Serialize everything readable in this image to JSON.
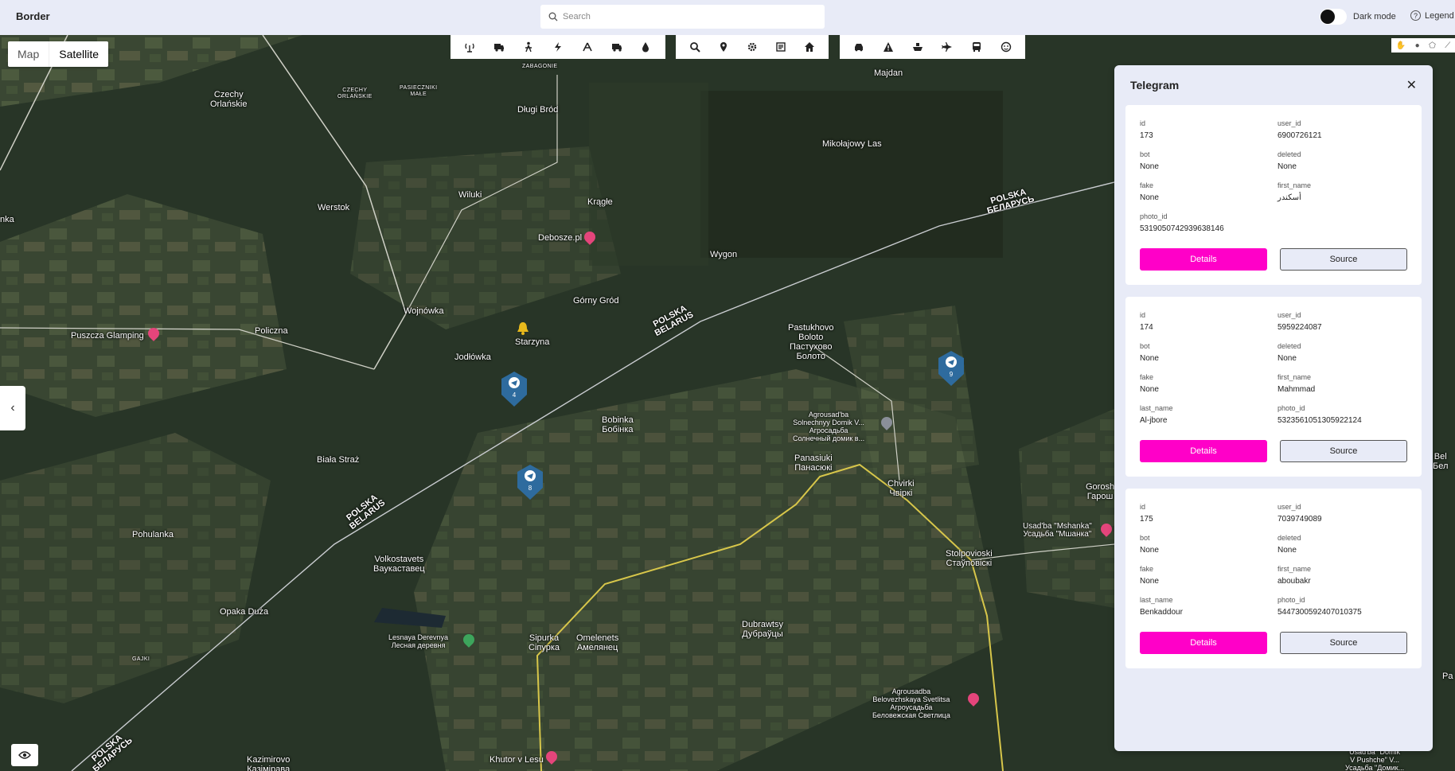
{
  "app": {
    "title": "Border"
  },
  "search": {
    "placeholder": "Search"
  },
  "header": {
    "dark_mode_label": "Dark mode",
    "legend_label": "Legend"
  },
  "map": {
    "type_map": "Map",
    "type_satellite": "Satellite",
    "places": [
      {
        "name": "ZABAGONIE"
      },
      {
        "name": "Majdan"
      },
      {
        "name": "Czechy\nOrlańskie"
      },
      {
        "name": "CZECHY\nORLAŃSKIE"
      },
      {
        "name": "PASIECZNIKI\nMAŁE"
      },
      {
        "name": "Długi Bród"
      },
      {
        "name": "Mikołajowy Las"
      },
      {
        "name": "Werstok"
      },
      {
        "name": "Wiluki"
      },
      {
        "name": "Krągłe"
      },
      {
        "name": "Debosze.pl"
      },
      {
        "name": "Wygon"
      },
      {
        "name": "Górny Gród"
      },
      {
        "name": "Wojnówka"
      },
      {
        "name": "Puszcza Glamping"
      },
      {
        "name": "Policzna"
      },
      {
        "name": "Starzyna"
      },
      {
        "name": "Jodłówka"
      },
      {
        "name": "Pastukhovo\nBoloto\nПастухово\nБолото"
      },
      {
        "name": "Bobinka\nБобінка"
      },
      {
        "name": "Agrousad'ba\nSolnechnyy Domik V...\nАгросадьба\nСолнечный домик в..."
      },
      {
        "name": "Biała Straż"
      },
      {
        "name": "Panasiuki\nПанасюкі"
      },
      {
        "name": "Chvirki\nЧвіркі"
      },
      {
        "name": "Pohulanka"
      },
      {
        "name": "Usad'ba \"Mshanka\"\nУсадьба \"Мшанка\""
      },
      {
        "name": "Stolpovioski\nСтаўповіскі"
      },
      {
        "name": "Volkostavets\nВаукаставец"
      },
      {
        "name": "Opaka Duża"
      },
      {
        "name": "Dubrawtsy\nДубраўцы"
      },
      {
        "name": "Lesnaya Derevnya\nЛесная деревня"
      },
      {
        "name": "Sipurka\nСіпурка"
      },
      {
        "name": "Omelenets\nАмелянец"
      },
      {
        "name": "GAJKI"
      },
      {
        "name": "Agrousadba\nBelovezhskaya Svetlitsa\nАгроусадьба\nБеловежская Светлица"
      },
      {
        "name": "Kazimirovo\nКазімірава"
      },
      {
        "name": "Khutor v Lesu"
      },
      {
        "name": "Usad'ba \"Domik\nV Pushche\" V...\nУсадьба \"Домик..."
      },
      {
        "name": "Gorosh\nГарош"
      },
      {
        "name": "nka"
      },
      {
        "name": "Bel\nБел"
      },
      {
        "name": "Pa"
      }
    ],
    "border_labels": [
      "POLSKA\nБЕЛАРУСЬ",
      "POLSKA\nBELARUS",
      "POLSKA\nBELARUS",
      "POLSKA\nБЕЛАРУСЬ"
    ],
    "markers": [
      {
        "count": "4"
      },
      {
        "count": "8"
      },
      {
        "count": "9"
      }
    ]
  },
  "panel": {
    "title": "Telegram",
    "details_label": "Details",
    "source_label": "Source",
    "records": [
      {
        "fields": [
          {
            "k": "id",
            "v": "173"
          },
          {
            "k": "user_id",
            "v": "6900726121"
          },
          {
            "k": "bot",
            "v": "None"
          },
          {
            "k": "deleted",
            "v": "None"
          },
          {
            "k": "fake",
            "v": "None"
          },
          {
            "k": "first_name",
            "v": "أسكندر"
          },
          {
            "k": "photo_id",
            "v": "5319050742939638146"
          }
        ]
      },
      {
        "fields": [
          {
            "k": "id",
            "v": "174"
          },
          {
            "k": "user_id",
            "v": "5959224087"
          },
          {
            "k": "bot",
            "v": "None"
          },
          {
            "k": "deleted",
            "v": "None"
          },
          {
            "k": "fake",
            "v": "None"
          },
          {
            "k": "first_name",
            "v": "Mahmmad"
          },
          {
            "k": "last_name",
            "v": "Al-jbore"
          },
          {
            "k": "photo_id",
            "v": "5323561051305922124"
          }
        ]
      },
      {
        "fields": [
          {
            "k": "id",
            "v": "175"
          },
          {
            "k": "user_id",
            "v": "7039749089"
          },
          {
            "k": "bot",
            "v": "None"
          },
          {
            "k": "deleted",
            "v": "None"
          },
          {
            "k": "fake",
            "v": "None"
          },
          {
            "k": "first_name",
            "v": "aboubakr"
          },
          {
            "k": "last_name",
            "v": "Benkaddour"
          },
          {
            "k": "photo_id",
            "v": "5447300592407010375"
          }
        ]
      }
    ]
  },
  "colors": {
    "accent": "#ff00c8",
    "marker": "#2e6b9e",
    "topbar": "#e8ebf7"
  },
  "icons": {
    "toolbar_group1": [
      "antenna-icon",
      "truck-icon",
      "person-icon",
      "lightning-icon",
      "network-icon",
      "lorry-icon",
      "water-drop-icon"
    ],
    "toolbar_group2": [
      "search-zoom-icon",
      "location-pin-icon",
      "gear-icon",
      "newspaper-icon",
      "house-icon"
    ],
    "toolbar_group3": [
      "car-icon",
      "warning-icon",
      "ship-icon",
      "plane-icon",
      "bus-icon",
      "face-icon"
    ]
  }
}
